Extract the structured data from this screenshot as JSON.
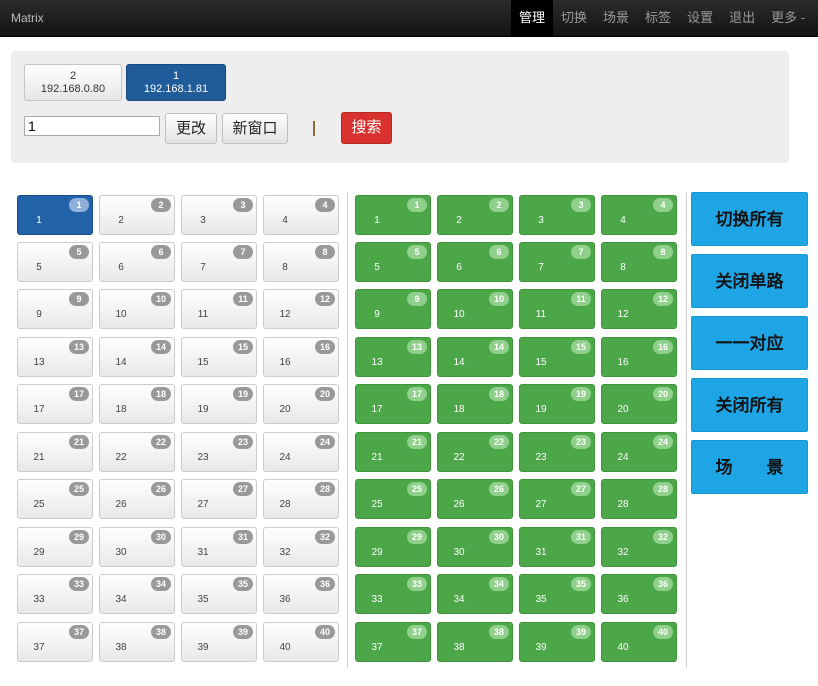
{
  "app": {
    "title": "Matrix"
  },
  "nav": {
    "items": [
      "管理",
      "切换",
      "场景",
      "标签",
      "设置",
      "退出",
      "更多 -"
    ]
  },
  "devices": [
    {
      "line1": "2",
      "line2": "192.168.0.80"
    },
    {
      "line1": "1",
      "line2": "192.168.1.81"
    }
  ],
  "controls": {
    "id_value": "1",
    "change_label": "更改",
    "new_window_label": "新窗口",
    "search_label": "搜索"
  },
  "inputs": {
    "count": 40,
    "selected": 1
  },
  "outputs": {
    "count": 40
  },
  "actions": {
    "switch_all": "切换所有",
    "close_single": "关闭单路",
    "one_to_one": "一一对应",
    "close_all": "关闭所有",
    "scene_left": "场",
    "scene_right": "景"
  }
}
